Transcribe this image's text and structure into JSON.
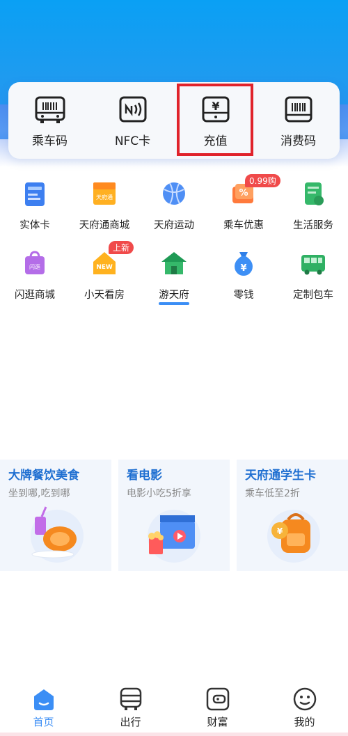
{
  "colors": {
    "brand_blue": "#1e9bf0",
    "highlight_red": "#e0232b",
    "badge_red": "#f04a4a",
    "accent": "#3b8ef5",
    "promo_title": "#1f6fd1"
  },
  "quick_actions": [
    {
      "label": "乘车码",
      "icon": "bus-qr-icon"
    },
    {
      "label": "NFC卡",
      "icon": "nfc-icon"
    },
    {
      "label": "充值",
      "icon": "recharge-yen-icon"
    },
    {
      "label": "消费码",
      "icon": "barcode-icon"
    }
  ],
  "services_row1": [
    {
      "label": "实体卡",
      "icon": "card-icon"
    },
    {
      "label": "天府通商城",
      "icon": "mall-icon",
      "icon_text": "天府通"
    },
    {
      "label": "天府运动",
      "icon": "sports-ball-icon"
    },
    {
      "label": "乘车优惠",
      "icon": "discount-icon",
      "badge": "0.99购"
    },
    {
      "label": "生活服务",
      "icon": "life-service-icon"
    }
  ],
  "services_row2": [
    {
      "label": "闪逛商城",
      "icon": "shopping-bag-icon",
      "icon_text": "闪逛"
    },
    {
      "label": "小天看房",
      "icon": "house-new-icon",
      "badge": "上新",
      "icon_text": "NEW"
    },
    {
      "label": "游天府",
      "icon": "tourism-house-icon"
    },
    {
      "label": "零钱",
      "icon": "money-bag-icon"
    },
    {
      "label": "定制包车",
      "icon": "custom-bus-icon"
    }
  ],
  "promos": [
    {
      "title": "大牌餐饮美食",
      "subtitle": "坐到哪,吃到哪",
      "icon": "food-icon"
    },
    {
      "title": "看电影",
      "subtitle": "电影小吃5折享",
      "icon": "movie-icon"
    },
    {
      "title": "天府通学生卡",
      "subtitle": "乘车低至2折",
      "icon": "student-bag-icon"
    }
  ],
  "tabs": [
    {
      "label": "首页",
      "icon": "home-icon",
      "active": true
    },
    {
      "label": "出行",
      "icon": "bus-icon",
      "active": false
    },
    {
      "label": "财富",
      "icon": "wallet-icon",
      "active": false
    },
    {
      "label": "我的",
      "icon": "profile-icon",
      "active": false
    }
  ]
}
